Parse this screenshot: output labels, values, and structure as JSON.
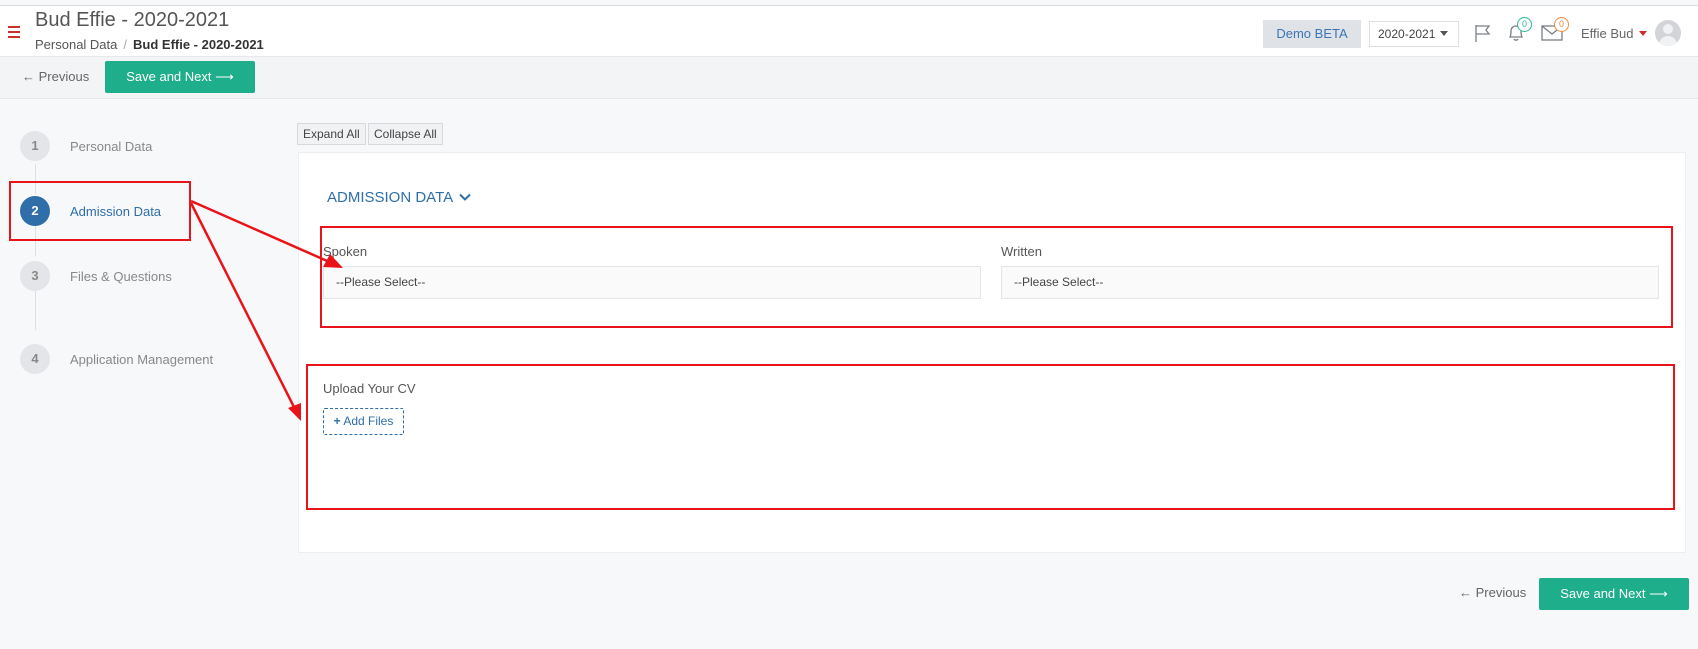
{
  "header": {
    "title": "Bud Effie - 2020-2021",
    "breadcrumb": {
      "parent": "Personal Data",
      "separator": "/",
      "current": "Bud Effie - 2020-2021"
    },
    "demo_badge": "Demo BETA",
    "year_select": "2020-2021",
    "notifications_count": "0",
    "messages_count": "0",
    "user_name": "Effie Bud",
    "icons": [
      "menu-icon",
      "flag-icon",
      "bell-icon",
      "envelope-icon",
      "avatar"
    ]
  },
  "toolbar": {
    "previous_label": "← Previous",
    "save_next_label": "Save and Next ⟶"
  },
  "steps": [
    {
      "number": "1",
      "label": "Personal Data"
    },
    {
      "number": "2",
      "label": "Admission Data"
    },
    {
      "number": "3",
      "label": "Files & Questions"
    },
    {
      "number": "4",
      "label": "Application Management"
    }
  ],
  "active_step": 2,
  "controls": {
    "expand_all": "Expand All",
    "collapse_all": "Collapse All"
  },
  "section": {
    "title": "ADMISSION DATA",
    "spoken_label": "Spoken",
    "spoken_value": "--Please Select--",
    "written_label": "Written",
    "written_value": "--Please Select--",
    "upload_label": "Upload Your CV",
    "add_files_label": "Add Files"
  },
  "footer": {
    "previous_label": "← Previous",
    "save_next_label": "Save and Next ⟶"
  },
  "colors": {
    "primary": "#1fae8b",
    "accent_blue": "#2f6ea8",
    "annotation_red": "#e8141a",
    "menu_red": "#c9302c"
  }
}
